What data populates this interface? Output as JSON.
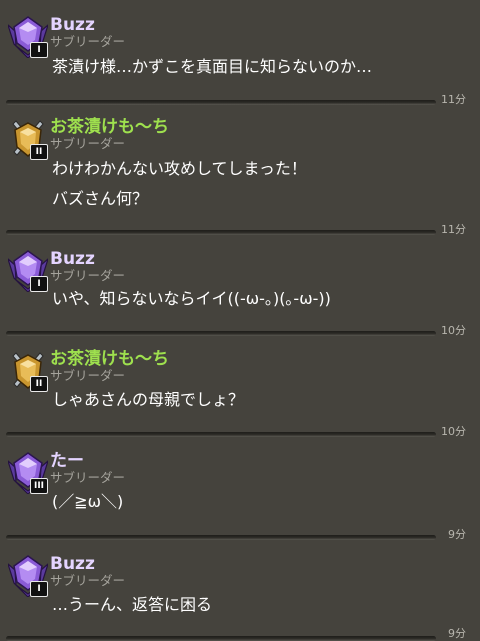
{
  "messages": [
    {
      "name": "Buzz",
      "role": "サブリーダー",
      "rank": "I",
      "badge": "purple-crystal-icon",
      "lines": [
        "茶漬け様…かずこを真面目に知らないのか…"
      ],
      "time": "11分"
    },
    {
      "name": "お茶漬けも〜ち",
      "role": "サブリーダー",
      "rank": "II",
      "badge": "gold-swords-icon",
      "lines": [
        "わけわかんない攻めしてしまった！",
        "バズさん何？"
      ],
      "time": "11分"
    },
    {
      "name": "Buzz",
      "role": "サブリーダー",
      "rank": "I",
      "badge": "purple-crystal-icon",
      "lines": [
        "いや、知らないならイイ((-ω-｡)(｡-ω-))"
      ],
      "time": "10分"
    },
    {
      "name": "お茶漬けも〜ち",
      "role": "サブリーダー",
      "rank": "II",
      "badge": "gold-swords-icon",
      "lines": [
        "しゃあさんの母親でしょ？"
      ],
      "time": "10分"
    },
    {
      "name": "たー",
      "role": "サブリーダー",
      "rank": "III",
      "badge": "purple-crystal-icon",
      "lines": [
        "(／≧ω＼)"
      ],
      "time": "9分"
    },
    {
      "name": "Buzz",
      "role": "サブリーダー",
      "rank": "I",
      "badge": "purple-crystal-icon",
      "lines": [
        "…うーん、返答に困る"
      ],
      "time": "9分"
    }
  ]
}
